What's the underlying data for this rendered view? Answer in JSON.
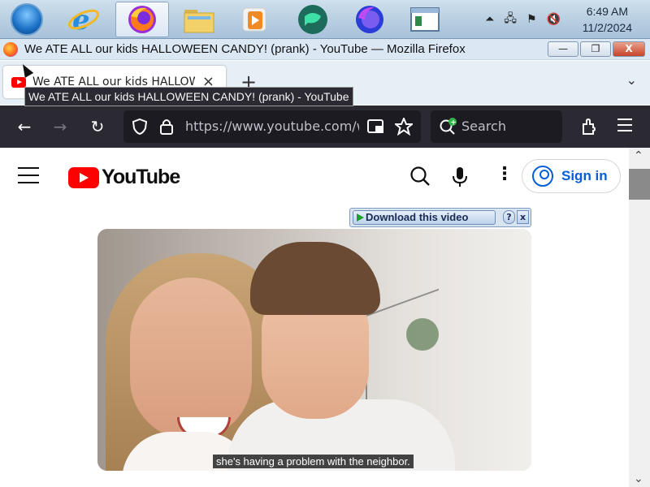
{
  "taskbar": {
    "apps": [
      {
        "name": "start",
        "icon": "windows-start-orb"
      },
      {
        "name": "internet-explorer",
        "icon": "internet-explorer-icon"
      },
      {
        "name": "firefox",
        "icon": "firefox-icon",
        "active": true
      },
      {
        "name": "file-explorer",
        "icon": "folder-icon"
      },
      {
        "name": "media-player",
        "icon": "media-player-icon"
      },
      {
        "name": "chat-app",
        "icon": "chat-bubble-icon"
      },
      {
        "name": "firefox-alt",
        "icon": "firefox-blue-icon"
      },
      {
        "name": "window-app",
        "icon": "window-icon"
      }
    ],
    "tray": {
      "show_hidden": "⏶",
      "network": "🖧",
      "flag": "⚑",
      "volume": "🔇"
    },
    "clock": {
      "time": "6:49 AM",
      "date": "11/2/2024"
    }
  },
  "window": {
    "title": "We ATE ALL our kids HALLOWEEN CANDY! (prank) - YouTube — Mozilla Firefox",
    "min_label": "—",
    "restore_label": "❐",
    "close_label": "X"
  },
  "tabs": [
    {
      "label": "We ATE ALL our kids HALLOWEEN CANDY! (prank) - YouTube",
      "close": "×"
    }
  ],
  "tabstrip": {
    "new_tab": "+",
    "list_all": "⌄"
  },
  "tooltip": "We ATE ALL our kids HALLOWEEN CANDY! (prank) - YouTube",
  "navbar": {
    "back": "←",
    "forward": "→",
    "reload": "↻",
    "url": "https://www.youtube.com/watch",
    "search_placeholder": "Search"
  },
  "youtube": {
    "logo_text": "YouTube",
    "more": "⋮",
    "sign_in": "Sign in"
  },
  "download_bar": {
    "label": "Download this video",
    "help": "?",
    "close": "x"
  },
  "video": {
    "caption": "she's having a problem with the neighbor."
  },
  "colors": {
    "yt_red": "#ff0000",
    "signin_blue": "#065fd4",
    "nav_dark": "#2b2a33"
  }
}
